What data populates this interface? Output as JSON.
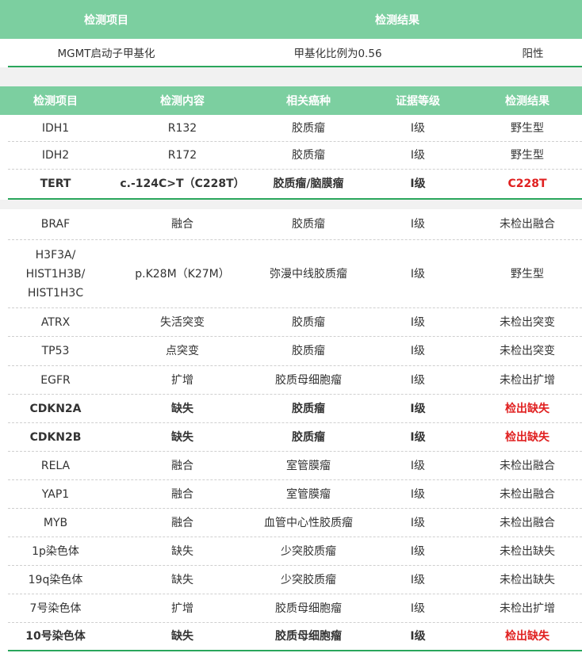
{
  "summary_table": {
    "headers": [
      "检测项目",
      "检测结果"
    ],
    "row": {
      "item": "MGMT启动子甲基化",
      "value": "甲基化比例为0.56",
      "result": "阳性"
    }
  },
  "detail_table": {
    "headers": [
      "检测项目",
      "检测内容",
      "相关癌种",
      "证据等级",
      "检测结果"
    ],
    "group1": [
      {
        "item": "IDH1",
        "content": "R132",
        "cancer": "胶质瘤",
        "level": "I级",
        "result": "野生型"
      },
      {
        "item": "IDH2",
        "content": "R172",
        "cancer": "胶质瘤",
        "level": "I级",
        "result": "野生型"
      },
      {
        "item": "TERT",
        "content": "c.-124C>T（C228T）",
        "cancer": "胶质瘤/脑膜瘤",
        "level": "I级",
        "result": "C228T"
      }
    ],
    "group2": [
      {
        "item": "BRAF",
        "content": "融合",
        "cancer": "胶质瘤",
        "level": "I级",
        "result": "未检出融合"
      },
      {
        "item": "H3F3A/\nHIST1H3B/\nHIST1H3C",
        "content": "p.K28M（K27M）",
        "cancer": "弥漫中线胶质瘤",
        "level": "I级",
        "result": "野生型"
      },
      {
        "item": "ATRX",
        "content": "失活突变",
        "cancer": "胶质瘤",
        "level": "I级",
        "result": "未检出突变"
      },
      {
        "item": "TP53",
        "content": "点突变",
        "cancer": "胶质瘤",
        "level": "I级",
        "result": "未检出突变"
      },
      {
        "item": "EGFR",
        "content": "扩增",
        "cancer": "胶质母细胞瘤",
        "level": "I级",
        "result": "未检出扩增"
      },
      {
        "item": "CDKN2A",
        "content": "缺失",
        "cancer": "胶质瘤",
        "level": "I级",
        "result": "检出缺失"
      },
      {
        "item": "CDKN2B",
        "content": "缺失",
        "cancer": "胶质瘤",
        "level": "I级",
        "result": "检出缺失"
      },
      {
        "item": "RELA",
        "content": "融合",
        "cancer": "室管膜瘤",
        "level": "I级",
        "result": "未检出融合"
      },
      {
        "item": "YAP1",
        "content": "融合",
        "cancer": "室管膜瘤",
        "level": "I级",
        "result": "未检出融合"
      },
      {
        "item": "MYB",
        "content": "融合",
        "cancer": "血管中心性胶质瘤",
        "level": "I级",
        "result": "未检出融合"
      },
      {
        "item": "1p染色体",
        "content": "缺失",
        "cancer": "少突胶质瘤",
        "level": "I级",
        "result": "未检出缺失"
      },
      {
        "item": "19q染色体",
        "content": "缺失",
        "cancer": "少突胶质瘤",
        "level": "I级",
        "result": "未检出缺失"
      },
      {
        "item": "7号染色体",
        "content": "扩增",
        "cancer": "胶质母细胞瘤",
        "level": "I级",
        "result": "未检出扩增"
      },
      {
        "item": "10号染色体",
        "content": "缺失",
        "cancer": "胶质母细胞瘤",
        "level": "I级",
        "result": "检出缺失"
      }
    ]
  },
  "colors": {
    "header_bg": "#7ccfa0",
    "accent_line": "#2aa65c",
    "positive_text": "#e02020"
  }
}
